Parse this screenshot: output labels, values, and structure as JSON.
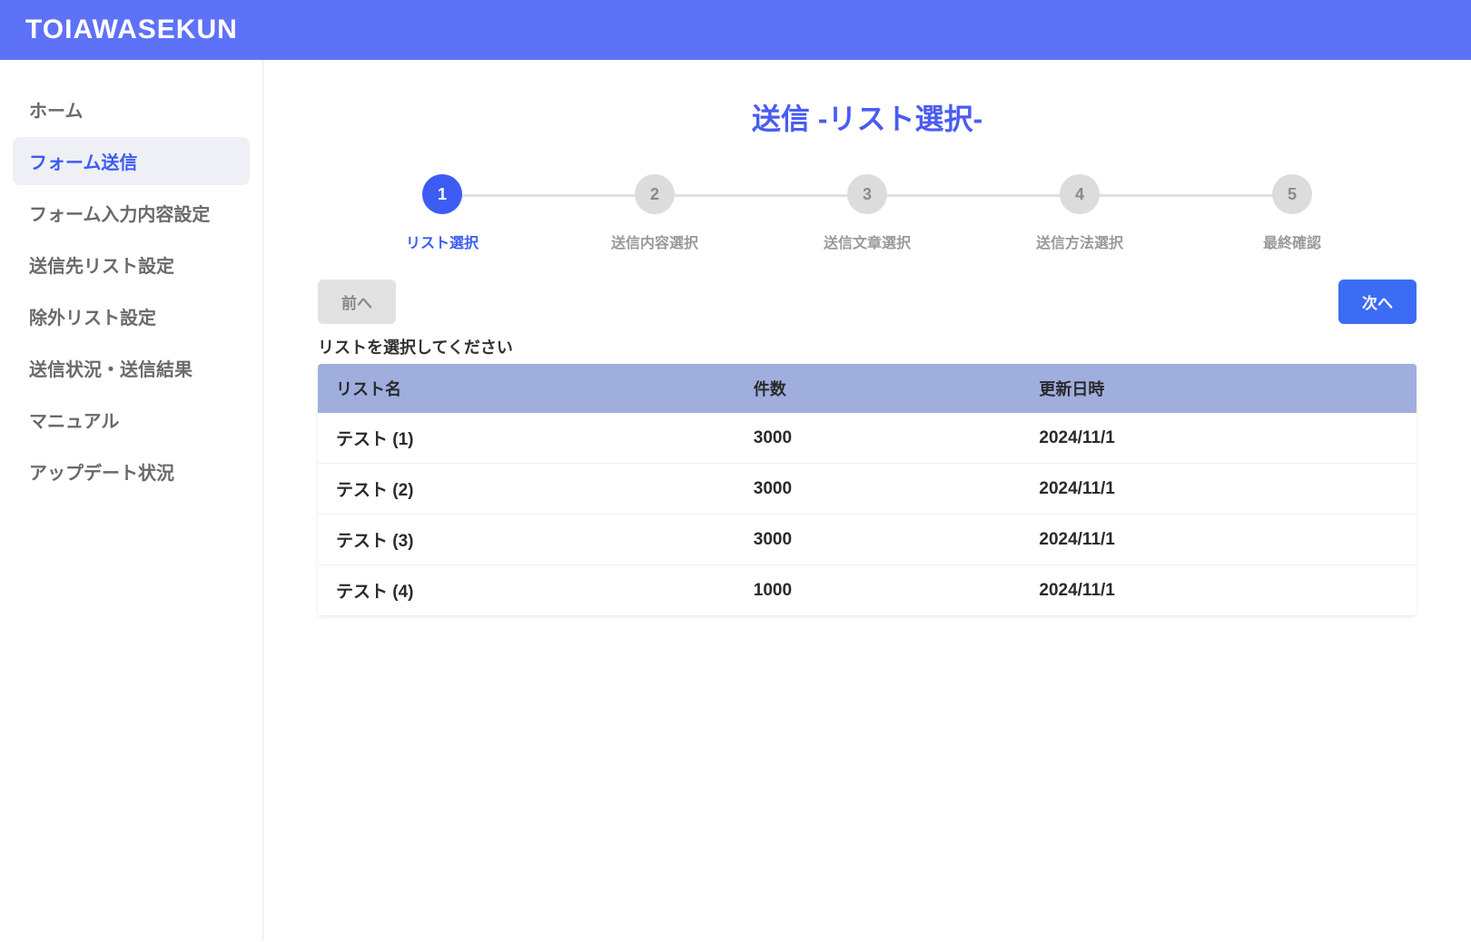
{
  "header": {
    "logo": "TOIAWASEKUN"
  },
  "sidebar": {
    "items": [
      {
        "label": "ホーム",
        "active": false
      },
      {
        "label": "フォーム送信",
        "active": true
      },
      {
        "label": "フォーム入力内容設定",
        "active": false
      },
      {
        "label": "送信先リスト設定",
        "active": false
      },
      {
        "label": "除外リスト設定",
        "active": false
      },
      {
        "label": "送信状況・送信結果",
        "active": false
      },
      {
        "label": "マニュアル",
        "active": false
      },
      {
        "label": "アップデート状況",
        "active": false
      }
    ]
  },
  "main": {
    "title": "送信 -リスト選択-",
    "stepper": [
      {
        "num": "1",
        "label": "リスト選択",
        "active": true
      },
      {
        "num": "2",
        "label": "送信内容選択",
        "active": false
      },
      {
        "num": "3",
        "label": "送信文章選択",
        "active": false
      },
      {
        "num": "4",
        "label": "送信方法選択",
        "active": false
      },
      {
        "num": "5",
        "label": "最終確認",
        "active": false
      }
    ],
    "prev_label": "前へ",
    "next_label": "次へ",
    "table_label": "リストを選択してください",
    "columns": {
      "name": "リスト名",
      "count": "件数",
      "date": "更新日時"
    },
    "rows": [
      {
        "name": "テスト (1)",
        "count": "3000",
        "date": "2024/11/1"
      },
      {
        "name": "テスト (2)",
        "count": "3000",
        "date": "2024/11/1"
      },
      {
        "name": "テスト (3)",
        "count": "3000",
        "date": "2024/11/1"
      },
      {
        "name": "テスト (4)",
        "count": "1000",
        "date": "2024/11/1"
      }
    ]
  }
}
